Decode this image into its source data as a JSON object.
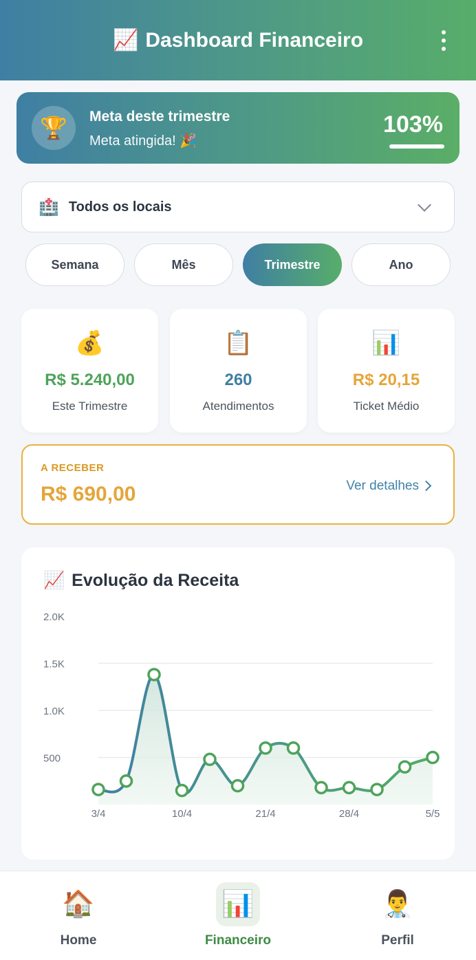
{
  "header": {
    "icon": "📈",
    "title": "Dashboard Financeiro",
    "menu_icon": "more-vertical-icon"
  },
  "goal": {
    "icon": "🏆",
    "title": "Meta deste trimestre",
    "subtitle": "Meta atingida! 🎉",
    "percent": "103%",
    "progress_fraction": 1.0
  },
  "location_filter": {
    "icon": "🏥",
    "selected": "Todos os locais"
  },
  "periods": [
    {
      "label": "Semana",
      "active": false
    },
    {
      "label": "Mês",
      "active": false
    },
    {
      "label": "Trimestre",
      "active": true
    },
    {
      "label": "Ano",
      "active": false
    }
  ],
  "stats": [
    {
      "icon": "💰",
      "value": "R$ 5.240,00",
      "label": "Este Trimestre",
      "color": "#4ea35a"
    },
    {
      "icon": "📋",
      "value": "260",
      "label": "Atendimentos",
      "color": "#3f7fa3"
    },
    {
      "icon": "📊",
      "value": "R$ 20,15",
      "label": "Ticket Médio",
      "color": "#e5a53a"
    }
  ],
  "receivable": {
    "label": "A RECEBER",
    "value": "R$ 690,00",
    "link": "Ver detalhes"
  },
  "chart_data": {
    "type": "line",
    "title": "Evolução da Receita",
    "title_icon": "📈",
    "x_labels": [
      "3/4",
      "10/4",
      "21/4",
      "28/4",
      "5/5"
    ],
    "x": [
      "3/4",
      "",
      "",
      "",
      "10/4",
      "",
      "",
      "",
      "21/4",
      "",
      "",
      "",
      "28/4",
      "",
      "",
      "5/5"
    ],
    "y": [
      160,
      250,
      1380,
      150,
      480,
      200,
      600,
      600,
      180,
      180,
      160,
      400,
      500
    ],
    "y_ticks": [
      "500",
      "1.0K",
      "1.5K",
      "2.0K"
    ],
    "ylim": [
      0,
      2000
    ],
    "grid": true,
    "colors": {
      "line": "#3f85a3",
      "point": "#4ea35a",
      "fill": "#e6f1ea"
    }
  },
  "bottom_nav": [
    {
      "icon": "🏠",
      "label": "Home",
      "active": false
    },
    {
      "icon": "📊",
      "label": "Financeiro",
      "active": true
    },
    {
      "icon": "👨‍⚕️",
      "label": "Perfil",
      "active": false
    }
  ]
}
